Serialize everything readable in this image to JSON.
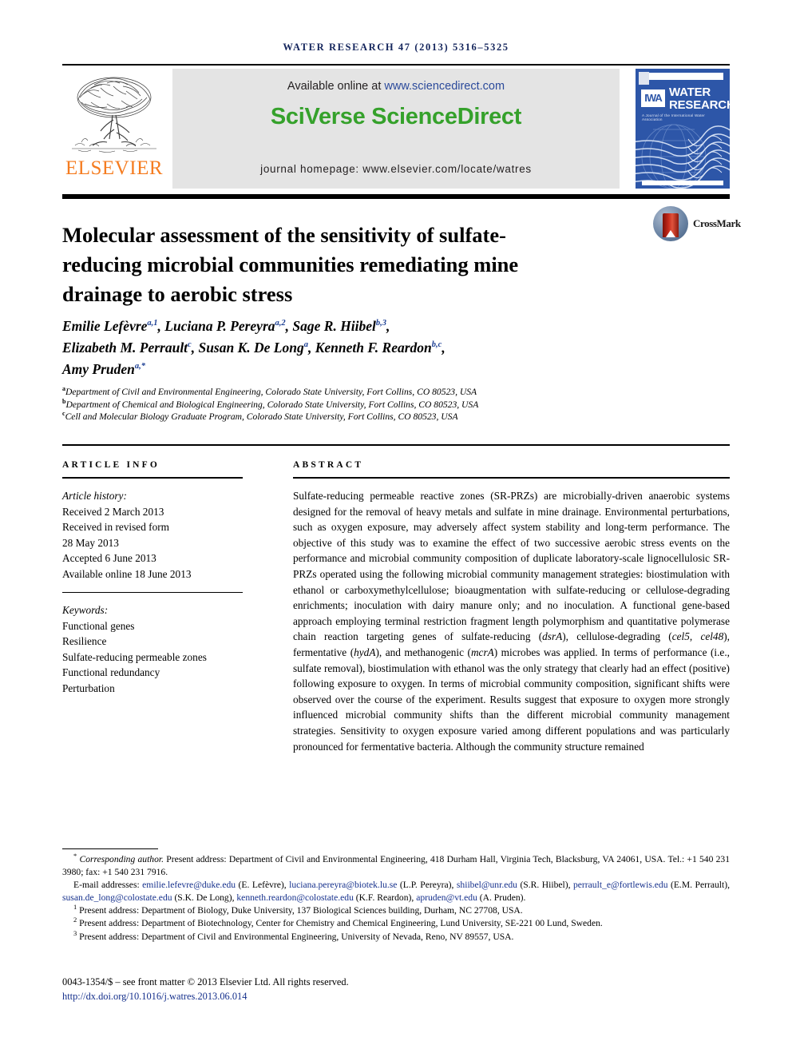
{
  "running_head": "WATER RESEARCH 47 (2013) 5316–5325",
  "masthead": {
    "publisher": "ELSEVIER",
    "available_prefix": "Available online at ",
    "available_url": "www.sciencedirect.com",
    "sciencedirect_logo": "SciVerse ScienceDirect",
    "journal_homepage": "journal homepage: www.elsevier.com/locate/watres",
    "cover": {
      "title_line1": "WATER",
      "title_line2": "RESEARCH",
      "society_logo": "IWA",
      "subtitle": "A Journal of the International Water Association"
    }
  },
  "article": {
    "title": "Molecular assessment of the sensitivity of sulfate-reducing microbial communities remediating mine drainage to aerobic stress",
    "crossmark_label": "CrossMark",
    "authors_html": "Emilie Lefèvre<sup>a,1</sup>, Luciana P. Pereyra<sup>a,2</sup>, Sage R. Hiibel<sup>b,3</sup>,<br>Elizabeth M. Perrault<sup>c</sup>, Susan K. De Long<sup>a</sup>, Kenneth F. Reardon<sup>b,c</sup>,<br>Amy Pruden<sup>a,*</sup>",
    "affiliations": [
      {
        "marker": "a",
        "text": "Department of Civil and Environmental Engineering, Colorado State University, Fort Collins, CO 80523, USA"
      },
      {
        "marker": "b",
        "text": "Department of Chemical and Biological Engineering, Colorado State University, Fort Collins, CO 80523, USA"
      },
      {
        "marker": "c",
        "text": "Cell and Molecular Biology Graduate Program, Colorado State University, Fort Collins, CO 80523, USA"
      }
    ]
  },
  "article_info": {
    "heading": "ARTICLE INFO",
    "history_label": "Article history:",
    "history": [
      "Received 2 March 2013",
      "Received in revised form",
      "28 May 2013",
      "Accepted 6 June 2013",
      "Available online 18 June 2013"
    ],
    "keywords_label": "Keywords:",
    "keywords": [
      "Functional genes",
      "Resilience",
      "Sulfate-reducing permeable zones",
      "Functional redundancy",
      "Perturbation"
    ]
  },
  "abstract": {
    "heading": "ABSTRACT",
    "text_html": "Sulfate-reducing permeable reactive zones (SR-PRZs) are microbially-driven anaerobic systems designed for the removal of heavy metals and sulfate in mine drainage. Environmental perturbations, such as oxygen exposure, may adversely affect system stability and long-term performance. The objective of this study was to examine the effect of two successive aerobic stress events on the performance and microbial community composition of duplicate laboratory-scale lignocellulosic SR-PRZs operated using the following microbial community management strategies: biostimulation with ethanol or carboxymethylcellulose; bioaugmentation with sulfate-reducing or cellulose-degrading enrichments; inoculation with dairy manure only; and no inoculation. A functional gene-based approach employing terminal restriction fragment length polymorphism and quantitative polymerase chain reaction targeting genes of sulfate-reducing (<i>dsrA</i>), cellulose-degrading (<i>cel5</i>, <i>cel48</i>), fermentative (<i>hydA</i>), and methanogenic (<i>mcrA</i>) microbes was applied. In terms of performance (i.e., sulfate removal), biostimulation with ethanol was the only strategy that clearly had an effect (positive) following exposure to oxygen. In terms of microbial community composition, significant shifts were observed over the course of the experiment. Results suggest that exposure to oxygen more strongly influenced microbial community shifts than the different microbial community management strategies. Sensitivity to oxygen exposure varied among different populations and was particularly pronounced for fermentative bacteria. Although the community structure remained"
  },
  "footnotes": {
    "corresponding_html": "<sup>*</sup> <i>Corresponding author.</i> Present address: Department of Civil and Environmental Engineering, 418 Durham Hall, Virginia Tech, Blacksburg, VA 24061, USA. Tel.: +1 540 231 3980; fax: +1 540 231 7916.",
    "emails_html": "E-mail addresses: <span class=\"lnk\">emilie.lefevre@duke.edu</span> (E. Lefèvre), <span class=\"lnk\">luciana.pereyra@biotek.lu.se</span> (L.P. Pereyra), <span class=\"lnk\">shiibel@unr.edu</span> (S.R. Hiibel), <span class=\"lnk\">perrault_e@fortlewis.edu</span> (E.M. Perrault), <span class=\"lnk\">susan.de_long@colostate.edu</span> (S.K. De Long), <span class=\"lnk\">kenneth.reardon@colostate.edu</span> (K.F. Reardon), <span class=\"lnk\">apruden@vt.edu</span> (A. Pruden).",
    "present_addresses_html": [
      "<sup>1</sup> Present address: Department of Biology, Duke University, 137 Biological Sciences building, Durham, NC 27708, USA.",
      "<sup>2</sup> Present address: Department of Biotechnology, Center for Chemistry and Chemical Engineering, Lund University, SE-221 00 Lund, Sweden.",
      "<sup>3</sup> Present address: Department of Civil and Environmental Engineering, University of Nevada, Reno, NV 89557, USA."
    ],
    "copyright": "0043-1354/$ – see front matter © 2013 Elsevier Ltd. All rights reserved.",
    "doi": "http://dx.doi.org/10.1016/j.watres.2013.06.014"
  },
  "colors": {
    "elsevier_orange": "#f57c20",
    "sciencedirect_green": "#35a12b",
    "link_blue": "#2b4a9b",
    "cover_blue": "#2d56a8",
    "runhead_navy": "#14255c"
  }
}
